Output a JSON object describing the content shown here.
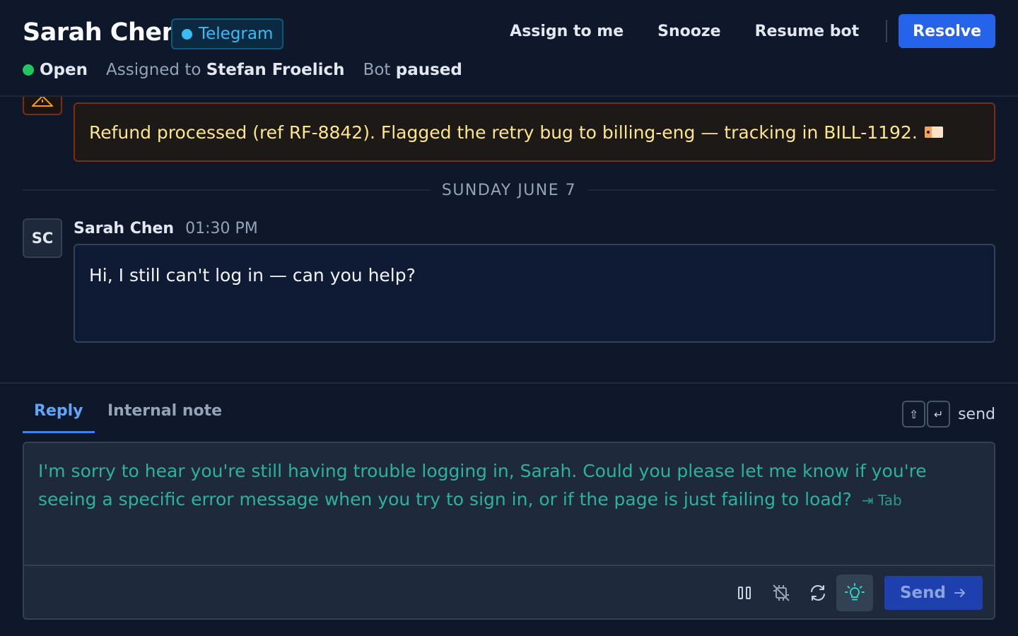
{
  "header": {
    "contact_name": "Sarah Chen",
    "channel": "Telegram",
    "actions": {
      "assign": "Assign to me",
      "snooze": "Snooze",
      "resume_bot": "Resume bot",
      "resolve": "Resolve"
    },
    "status": {
      "state": "Open",
      "assigned_prefix": "Assigned to",
      "assignee": "Stefan Froelich",
      "bot_prefix": "Bot",
      "bot_state": "paused"
    }
  },
  "conversation": {
    "internal_note": {
      "text": "Refund processed (ref RF-8842). Flagged the retry bug to billing-eng — tracking in BILL-1192."
    },
    "date_divider": "SUNDAY JUNE 7",
    "message": {
      "avatar_initials": "SC",
      "author": "Sarah Chen",
      "time": "01:30 PM",
      "text": "Hi, I still can't log in — can you help?"
    }
  },
  "composer": {
    "tabs": {
      "reply": "Reply",
      "internal_note": "Internal note"
    },
    "shortcut": {
      "key1": "⇧",
      "key2": "↵",
      "label": "send"
    },
    "suggestion": "I'm sorry to hear you're still having trouble logging in, Sarah. Could you please let me know if you're seeing a specific error message when you try to sign in, or if the page is just failing to load?",
    "tab_hint": "⇥ Tab",
    "send_label": "Send",
    "toolbar_icons": [
      "pause-icon",
      "ai-off-icon",
      "refresh-icon",
      "lightbulb-icon"
    ]
  },
  "colors": {
    "background": "#0f172a",
    "accent": "#2563eb",
    "suggestion_text": "#2bb3a0",
    "note_border": "#7c2d12",
    "note_text": "#fde68a",
    "status_open": "#22c55e",
    "channel": "#38bdf8"
  }
}
